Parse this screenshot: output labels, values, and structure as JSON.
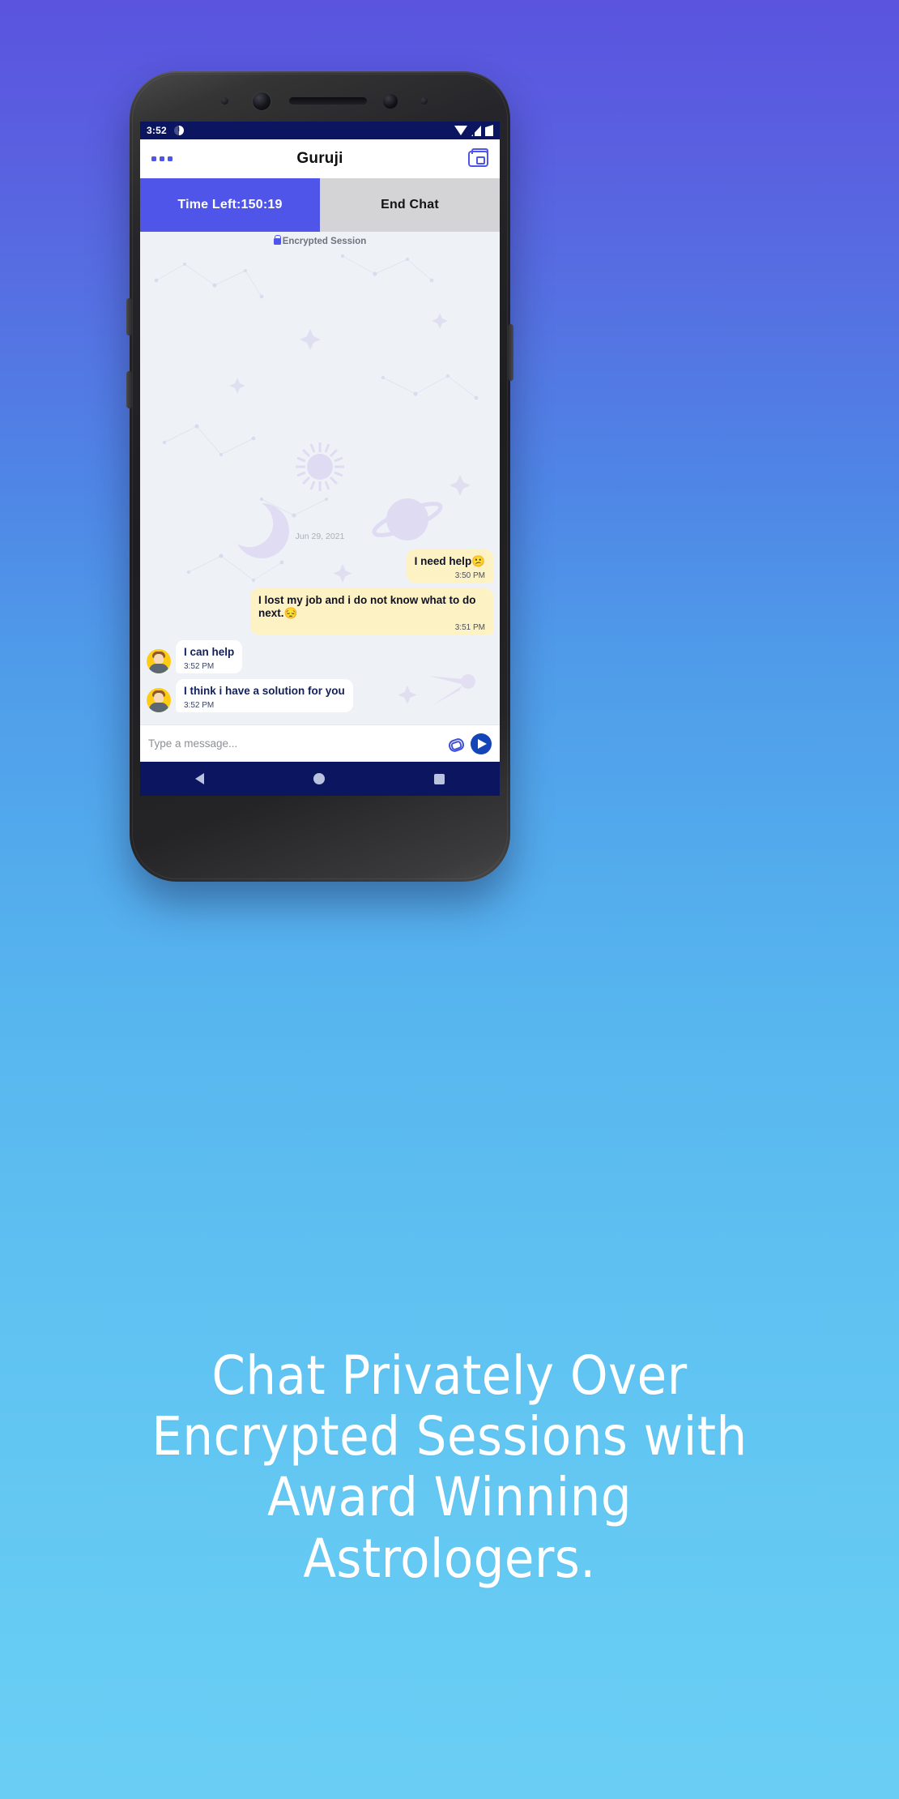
{
  "promo": {
    "caption_lines": [
      "Chat Privately Over",
      "Encrypted Sessions with",
      "Award Winning",
      "Astrologers."
    ],
    "background_top_color": "#5a54df",
    "background_bottom_color": "#6acef4"
  },
  "status_bar": {
    "time": "3:52",
    "icons": [
      "clock-icon",
      "wifi-icon",
      "signal-icon",
      "battery-icon"
    ],
    "background_color": "#0b1560"
  },
  "app_bar": {
    "title": "Guruji",
    "menu_icon": "three-dots-icon",
    "wallet_icon": "wallet-icon",
    "accent_color": "#4f55e8"
  },
  "tabs": [
    {
      "label": "Time Left:150:19",
      "active": true
    },
    {
      "label": "End Chat",
      "active": false
    }
  ],
  "chat": {
    "encrypted_label": "Encrypted Session",
    "lock_icon": "lock-icon",
    "date_separator": "Jun 29, 2021",
    "messages": [
      {
        "text": "I need help😕",
        "time": "3:50 PM",
        "direction": "outgoing"
      },
      {
        "text": "I lost my job and i do not know what to do next.😔",
        "time": "3:51 PM",
        "direction": "outgoing"
      },
      {
        "text": "I can help",
        "time": "3:52 PM",
        "direction": "incoming",
        "avatar": "astrologer-avatar"
      },
      {
        "text": "I think i have a solution for you",
        "time": "3:52 PM",
        "direction": "incoming",
        "avatar": "astrologer-avatar"
      }
    ],
    "outgoing_bubble_color": "#fdf2c4",
    "incoming_bubble_color": "#ffffff"
  },
  "composer": {
    "placeholder": "Type a message...",
    "attach_icon": "paperclip-icon",
    "send_icon": "send-icon"
  },
  "nav_bar": {
    "back_icon": "back-triangle-icon",
    "home_icon": "home-circle-icon",
    "recents_icon": "recents-square-icon"
  }
}
